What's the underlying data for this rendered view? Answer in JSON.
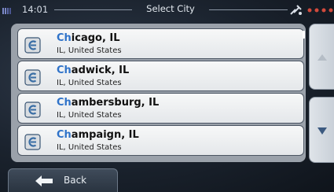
{
  "status_bar": {
    "time": "14:01",
    "title": "Select City",
    "icons": [
      "battery-icon",
      "satellite-icon",
      "menu-dots-icon"
    ]
  },
  "results": [
    {
      "highlight": "Ch",
      "rest": "icago, IL",
      "subtitle": "IL, United States",
      "icon": "city-icon"
    },
    {
      "highlight": "Ch",
      "rest": "adwick, IL",
      "subtitle": "IL, United States",
      "icon": "city-icon"
    },
    {
      "highlight": "Ch",
      "rest": "ambersburg, IL",
      "subtitle": "IL, United States",
      "icon": "city-icon"
    },
    {
      "highlight": "Ch",
      "rest": "ampaign, IL",
      "subtitle": "IL, United States",
      "icon": "city-icon"
    }
  ],
  "scroll": {
    "up_icon": "chevron-up-icon",
    "down_icon": "chevron-down-icon"
  },
  "footer": {
    "back_label": "Back",
    "back_icon": "back-arrow-icon"
  },
  "colors": {
    "highlight": "#2f73c9",
    "list_bg": "#9aa1aa"
  }
}
